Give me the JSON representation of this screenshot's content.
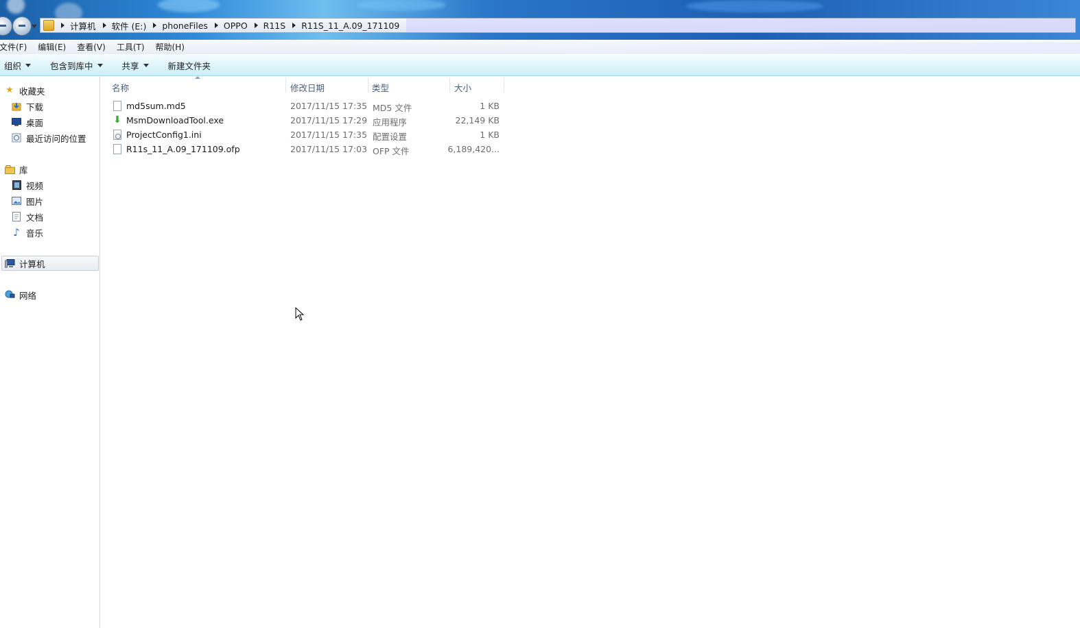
{
  "address": {
    "crumbs": [
      "计算机",
      "软件 (E:)",
      "phoneFiles",
      "OPPO",
      "R11S",
      "R11S_11_A.09_171109"
    ]
  },
  "menu": {
    "items": [
      "文件(F)",
      "编辑(E)",
      "查看(V)",
      "工具(T)",
      "帮助(H)"
    ]
  },
  "toolbar": {
    "organize": "组织",
    "include_in_library": "包含到库中",
    "share": "共享",
    "new_folder": "新建文件夹"
  },
  "nav": {
    "favorites": "收藏夹",
    "downloads": "下载",
    "desktop": "桌面",
    "recent": "最近访问的位置",
    "libraries": "库",
    "videos": "视频",
    "pictures": "图片",
    "documents": "文档",
    "music": "音乐",
    "computer": "计算机",
    "network": "网络"
  },
  "columns": {
    "name": "名称",
    "modified": "修改日期",
    "type": "类型",
    "size": "大小"
  },
  "files": [
    {
      "name": "md5sum.md5",
      "modified": "2017/11/15 17:35",
      "type": "MD5 文件",
      "size": "1 KB"
    },
    {
      "name": "MsmDownloadTool.exe",
      "modified": "2017/11/15 17:29",
      "type": "应用程序",
      "size": "22,149 KB"
    },
    {
      "name": "ProjectConfig1.ini",
      "modified": "2017/11/15 17:35",
      "type": "配置设置",
      "size": "1 KB"
    },
    {
      "name": "R11s_11_A.09_171109.ofp",
      "modified": "2017/11/15 17:03",
      "type": "OFP 文件",
      "size": "6,189,420..."
    }
  ]
}
